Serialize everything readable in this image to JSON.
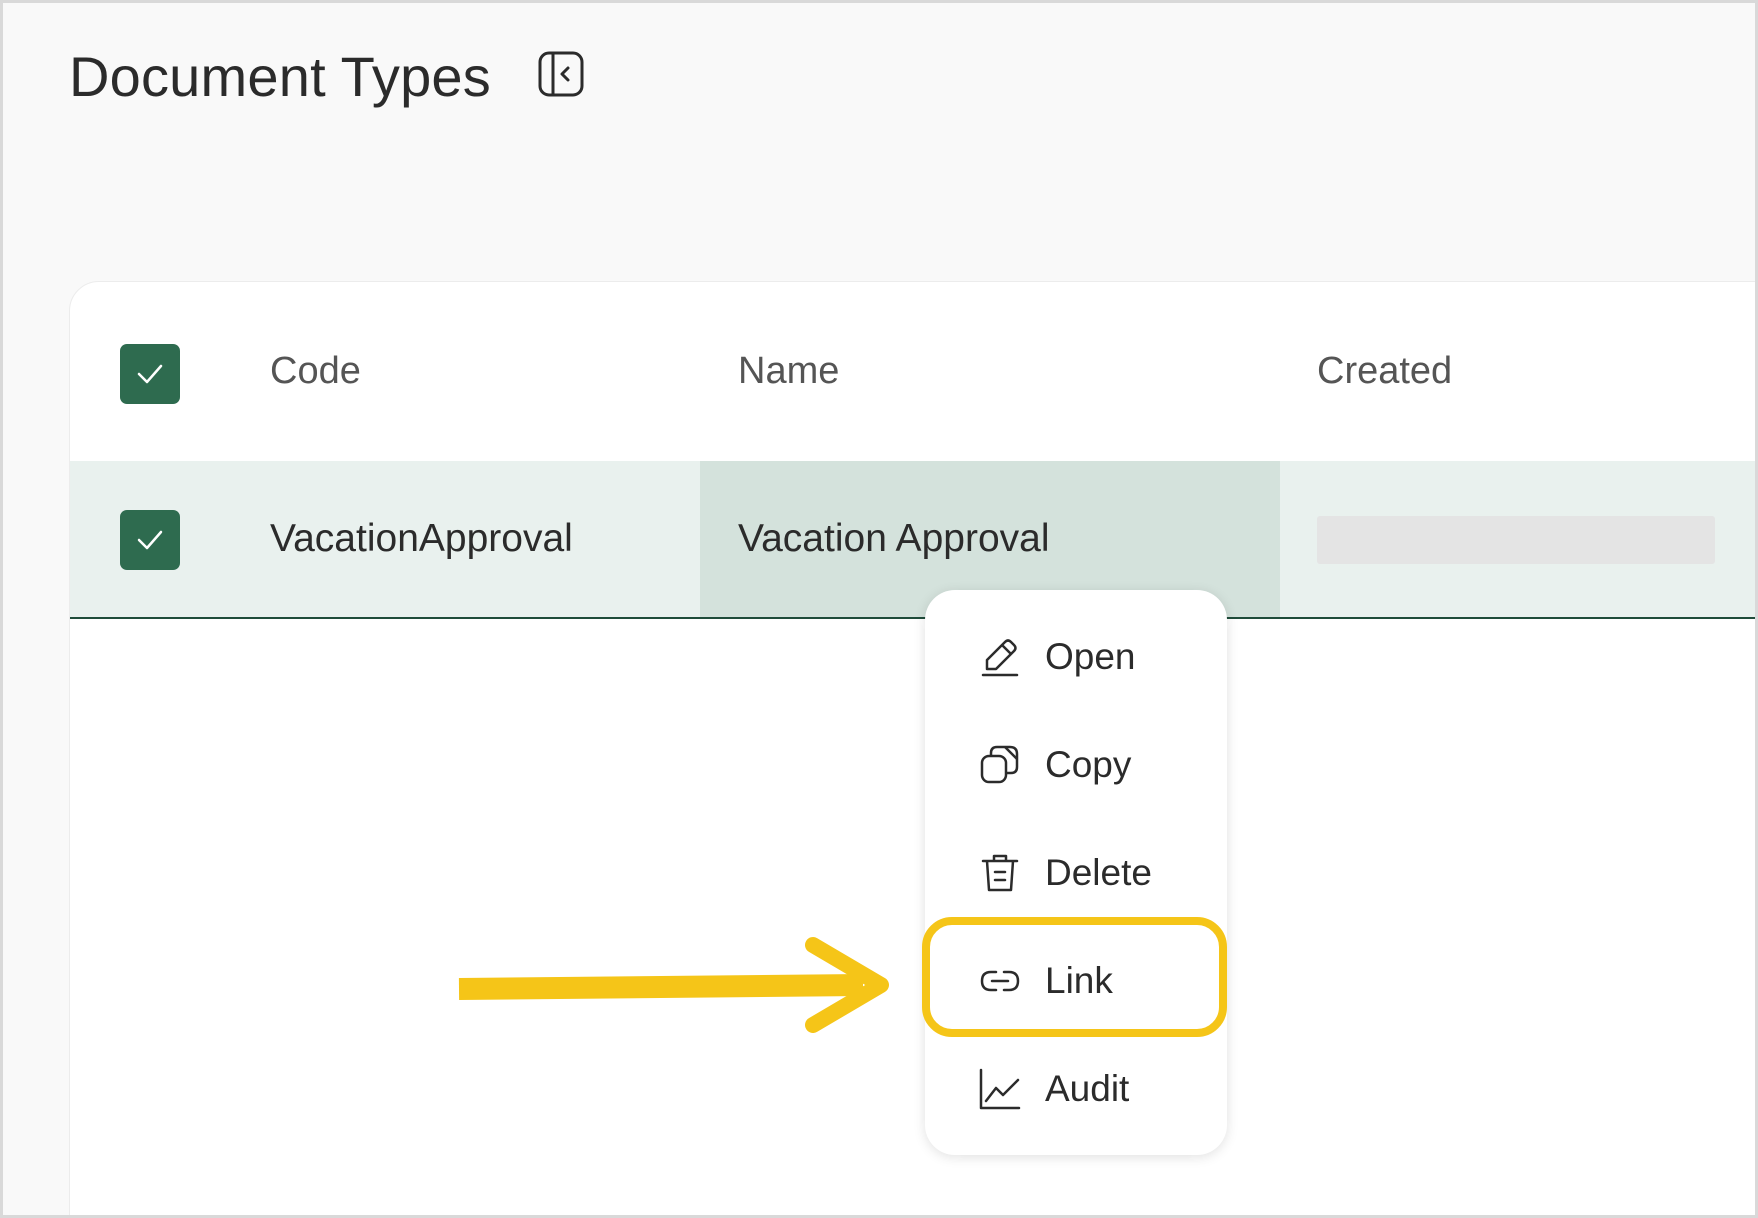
{
  "page": {
    "title": "Document Types"
  },
  "table": {
    "columns": [
      "Code",
      "Name",
      "Created"
    ],
    "rows": [
      {
        "code": "VacationApproval",
        "name": "Vacation Approval",
        "created": ""
      }
    ]
  },
  "context_menu": {
    "items": [
      {
        "label": "Open",
        "icon": "pencil-icon"
      },
      {
        "label": "Copy",
        "icon": "copy-icon"
      },
      {
        "label": "Delete",
        "icon": "trash-icon"
      },
      {
        "label": "Link",
        "icon": "link-icon"
      },
      {
        "label": "Audit",
        "icon": "chart-icon"
      }
    ],
    "highlighted_item": "Link"
  },
  "colors": {
    "accent_green": "#2e6b4f",
    "row_selected": "#e9f1ee",
    "cell_focus": "#d4e2dc",
    "highlight_yellow": "#f5c518"
  }
}
